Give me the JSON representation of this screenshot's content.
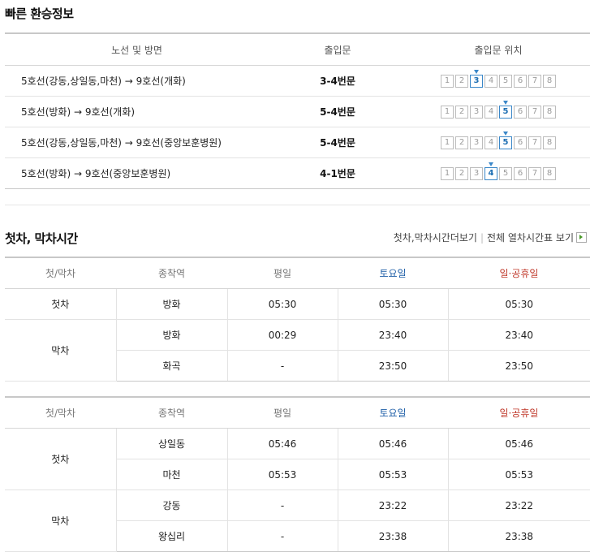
{
  "transfer": {
    "title": "빠른 환승정보",
    "headers": [
      "노선 및 방면",
      "출입문",
      "출입문 위치"
    ],
    "doors": [
      "1",
      "2",
      "3",
      "4",
      "5",
      "6",
      "7",
      "8"
    ],
    "rows": [
      {
        "route": "5호선(강동,상일동,마천) → 9호선(개화)",
        "exit": "3-4번문",
        "active_door": 3
      },
      {
        "route": "5호선(방화) → 9호선(개화)",
        "exit": "5-4번문",
        "active_door": 5
      },
      {
        "route": "5호선(강동,상일동,마천) → 9호선(중앙보훈병원)",
        "exit": "5-4번문",
        "active_door": 5
      },
      {
        "route": "5호선(방화) → 9호선(중앙보훈병원)",
        "exit": "4-1번문",
        "active_door": 4
      }
    ]
  },
  "schedule": {
    "title": "첫차, 막차시간",
    "link_more": "첫차,막차시간더보기",
    "link_all": "전체 열차시간표 보기",
    "colors": {
      "saturday": "#1f5fa8",
      "holiday": "#c0392b"
    },
    "headers": [
      "첫/막차",
      "종착역",
      "평일",
      "토요일",
      "일·공휴일"
    ],
    "tables": [
      {
        "groups": [
          {
            "kind": "첫차",
            "rows": [
              {
                "station": "방화",
                "weekday": "05:30",
                "saturday": "05:30",
                "holiday": "05:30"
              }
            ]
          },
          {
            "kind": "막차",
            "rows": [
              {
                "station": "방화",
                "weekday": "00:29",
                "saturday": "23:40",
                "holiday": "23:40"
              },
              {
                "station": "화곡",
                "weekday": "-",
                "saturday": "23:50",
                "holiday": "23:50"
              }
            ]
          }
        ]
      },
      {
        "groups": [
          {
            "kind": "첫차",
            "rows": [
              {
                "station": "상일동",
                "weekday": "05:46",
                "saturday": "05:46",
                "holiday": "05:46"
              },
              {
                "station": "마천",
                "weekday": "05:53",
                "saturday": "05:53",
                "holiday": "05:53"
              }
            ]
          },
          {
            "kind": "막차",
            "rows": [
              {
                "station": "강동",
                "weekday": "-",
                "saturday": "23:22",
                "holiday": "23:22"
              },
              {
                "station": "왕십리",
                "weekday": "-",
                "saturday": "23:38",
                "holiday": "23:38"
              }
            ]
          }
        ]
      }
    ]
  }
}
